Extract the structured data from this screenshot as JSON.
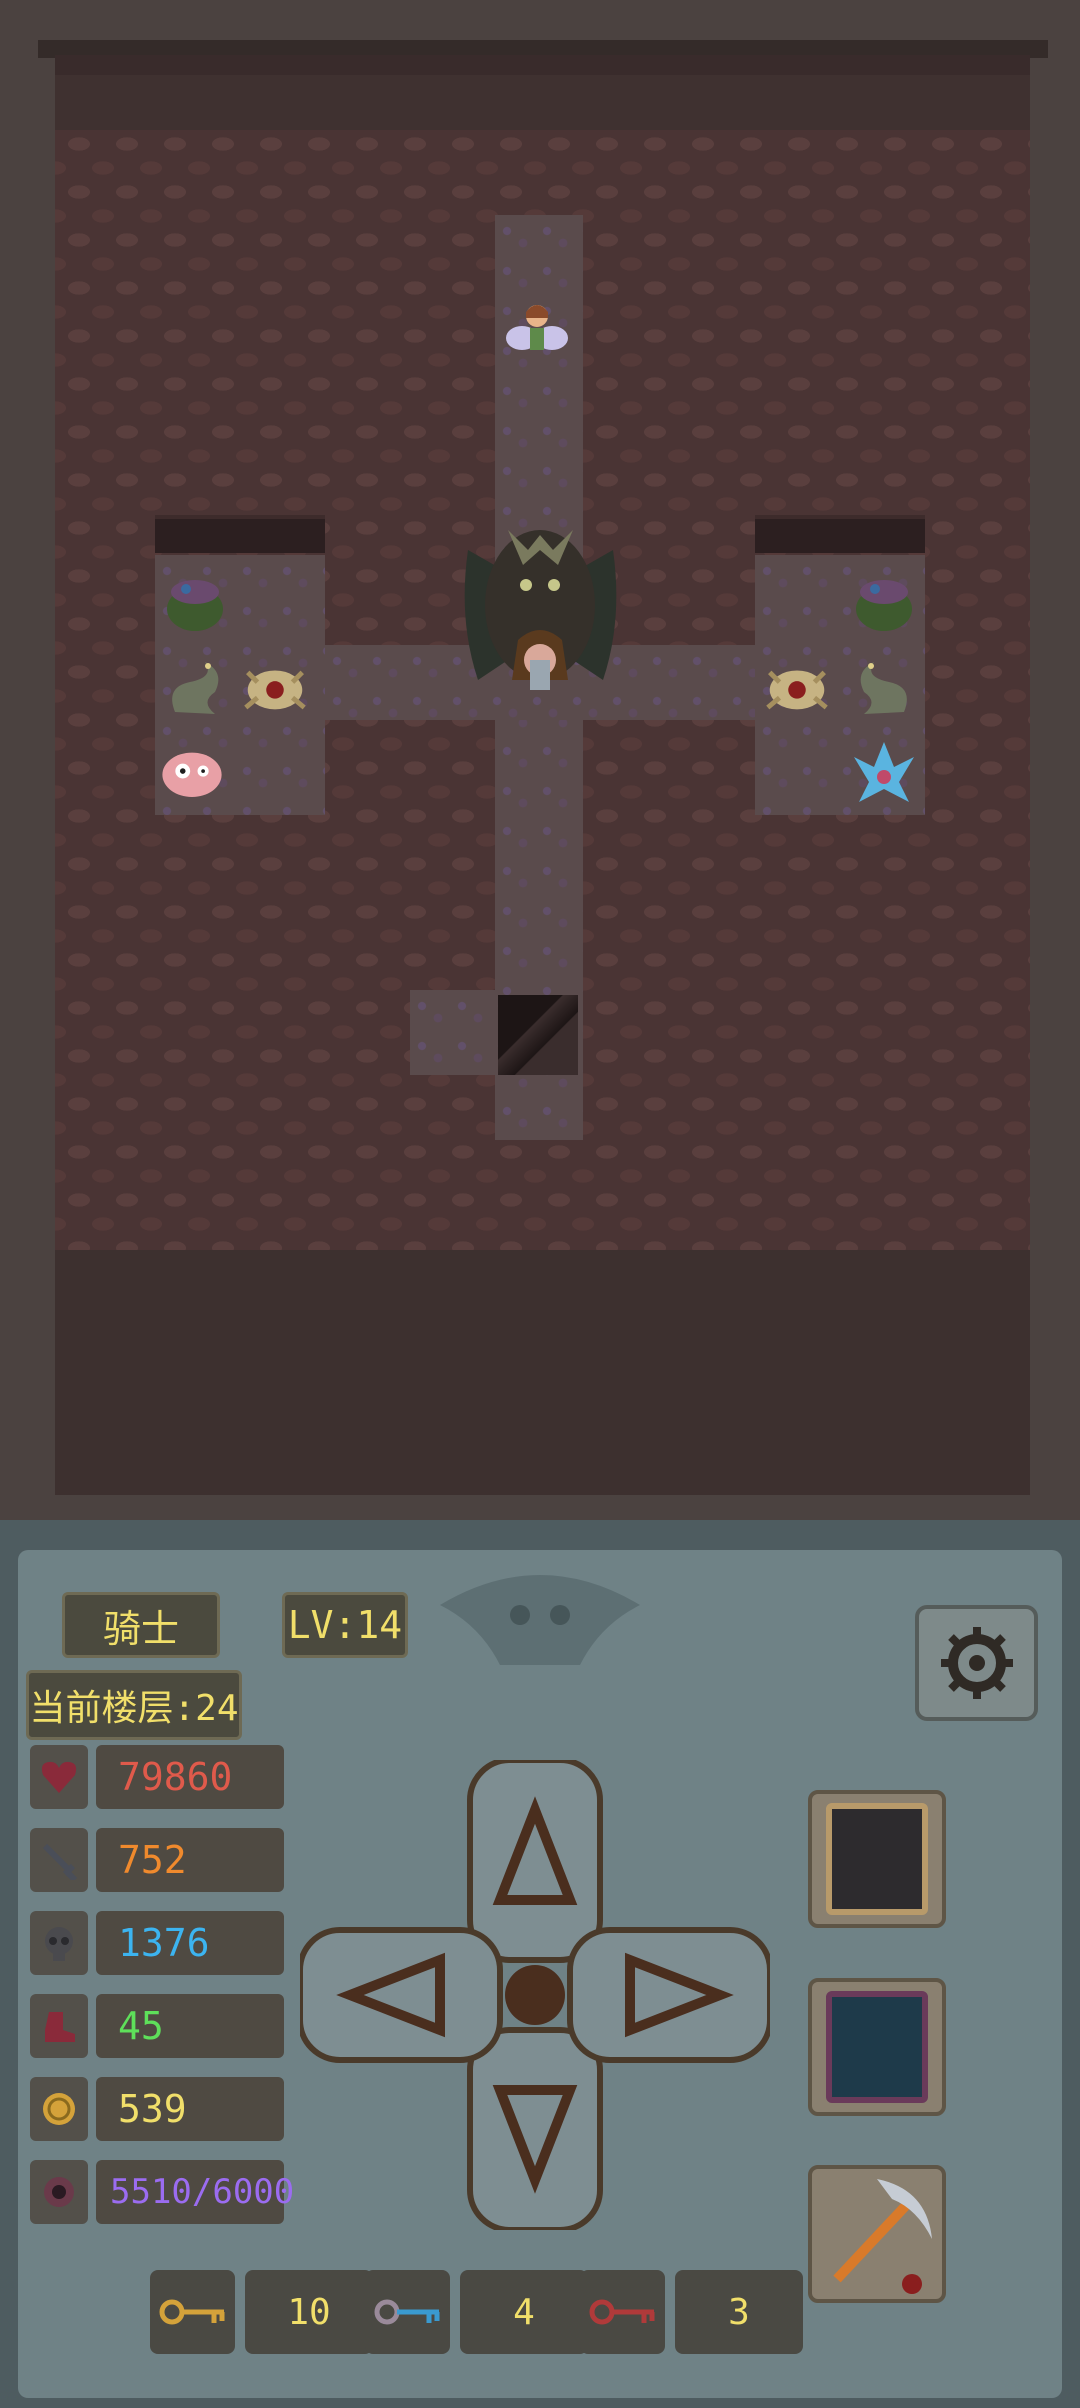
{
  "player": {
    "class_name": "骑士",
    "level": "LV:14",
    "floor": "当前楼层:24"
  },
  "stats": [
    {
      "name": "hp",
      "icon": "heart-icon",
      "value": "79860",
      "color": "#e05a4b"
    },
    {
      "name": "attack",
      "icon": "sword-icon",
      "value": "752",
      "color": "#f08a2d"
    },
    {
      "name": "defense",
      "icon": "skull-shield-icon",
      "value": "1376",
      "color": "#3cb4f0"
    },
    {
      "name": "speed",
      "icon": "boot-icon",
      "value": "45",
      "color": "#5ee05a"
    },
    {
      "name": "gold",
      "icon": "coin-icon",
      "value": "539",
      "color": "#f1df6a"
    },
    {
      "name": "experience",
      "icon": "orb-icon",
      "value": "5510/6000",
      "color": "#9b6cf0"
    }
  ],
  "keys": [
    {
      "name": "yellow-key",
      "count": "10"
    },
    {
      "name": "blue-key",
      "count": "4"
    },
    {
      "name": "red-key",
      "count": "3"
    }
  ],
  "icons": {
    "settings": "gear-icon",
    "slot1": "dark-portal-icon",
    "slot2": "monster-book-icon",
    "slot3": "pickaxe-icon"
  }
}
